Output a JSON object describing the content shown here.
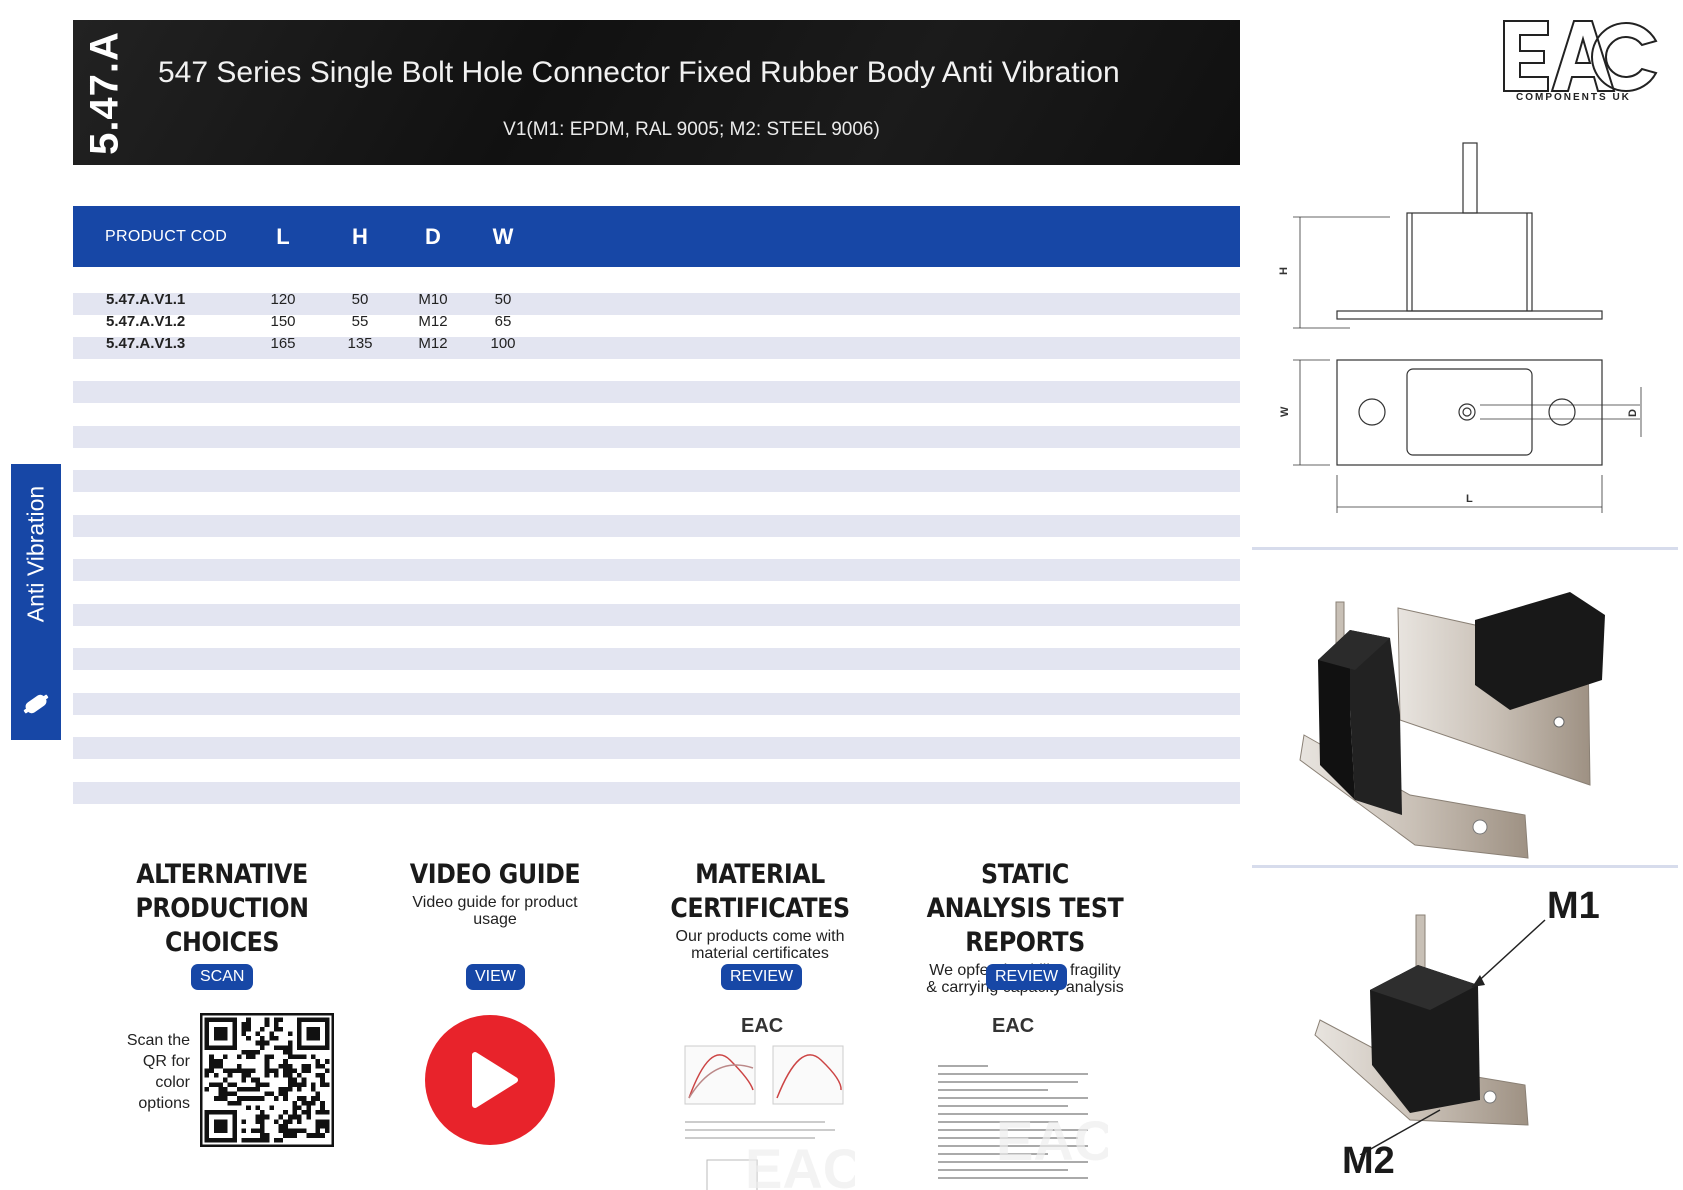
{
  "header": {
    "code": "5.47.A",
    "title": "547 Series Single Bolt Hole Connector Fixed Rubber Body Anti Vibration",
    "subtitle": "V1(M1: EPDM, RAL 9005; M2: STEEL 9006)"
  },
  "table": {
    "headers": [
      "PRODUCT COD",
      "L",
      "H",
      "D",
      "W"
    ],
    "rows": [
      [
        "5.47.A.V1.1",
        "120",
        "50",
        "M10",
        "50"
      ],
      [
        "5.47.A.V1.2",
        "150",
        "55",
        "M12",
        "65"
      ],
      [
        "5.47.A.V1.3",
        "165",
        "135",
        "M12",
        "100"
      ]
    ]
  },
  "sidetab": {
    "label": "Anti Vibration",
    "icon": "anti-vibration-mount-icon"
  },
  "logo": {
    "text": "EAC",
    "subtext": "COMPONENTS UK"
  },
  "drawing": {
    "labels": {
      "h": "H",
      "w": "W",
      "d": "D",
      "l": "L"
    }
  },
  "material_labels": {
    "m1": "M1",
    "m2": "M2"
  },
  "sections": [
    {
      "title": "ALTERNATIVE PRODUCTION CHOICES",
      "description": "",
      "button": "SCAN",
      "scan_text": "Scan the QR for color options"
    },
    {
      "title": "VIDEO GUIDE",
      "description": "Video guide for product usage",
      "button": "VIEW"
    },
    {
      "title": "MATERIAL CERTIFICATES",
      "description": "Our products come with material certificates",
      "button": "REVIEW"
    },
    {
      "title": "STATIC ANALYSIS TEST REPORTS",
      "description": "We opfer durability, fragility & carrying capacity analysis",
      "button": "REVIEW"
    }
  ],
  "colors": {
    "brand_blue": "#1747a6",
    "stripe": "#e3e5f1",
    "banner": "#151515",
    "play_red": "#e8232b"
  }
}
